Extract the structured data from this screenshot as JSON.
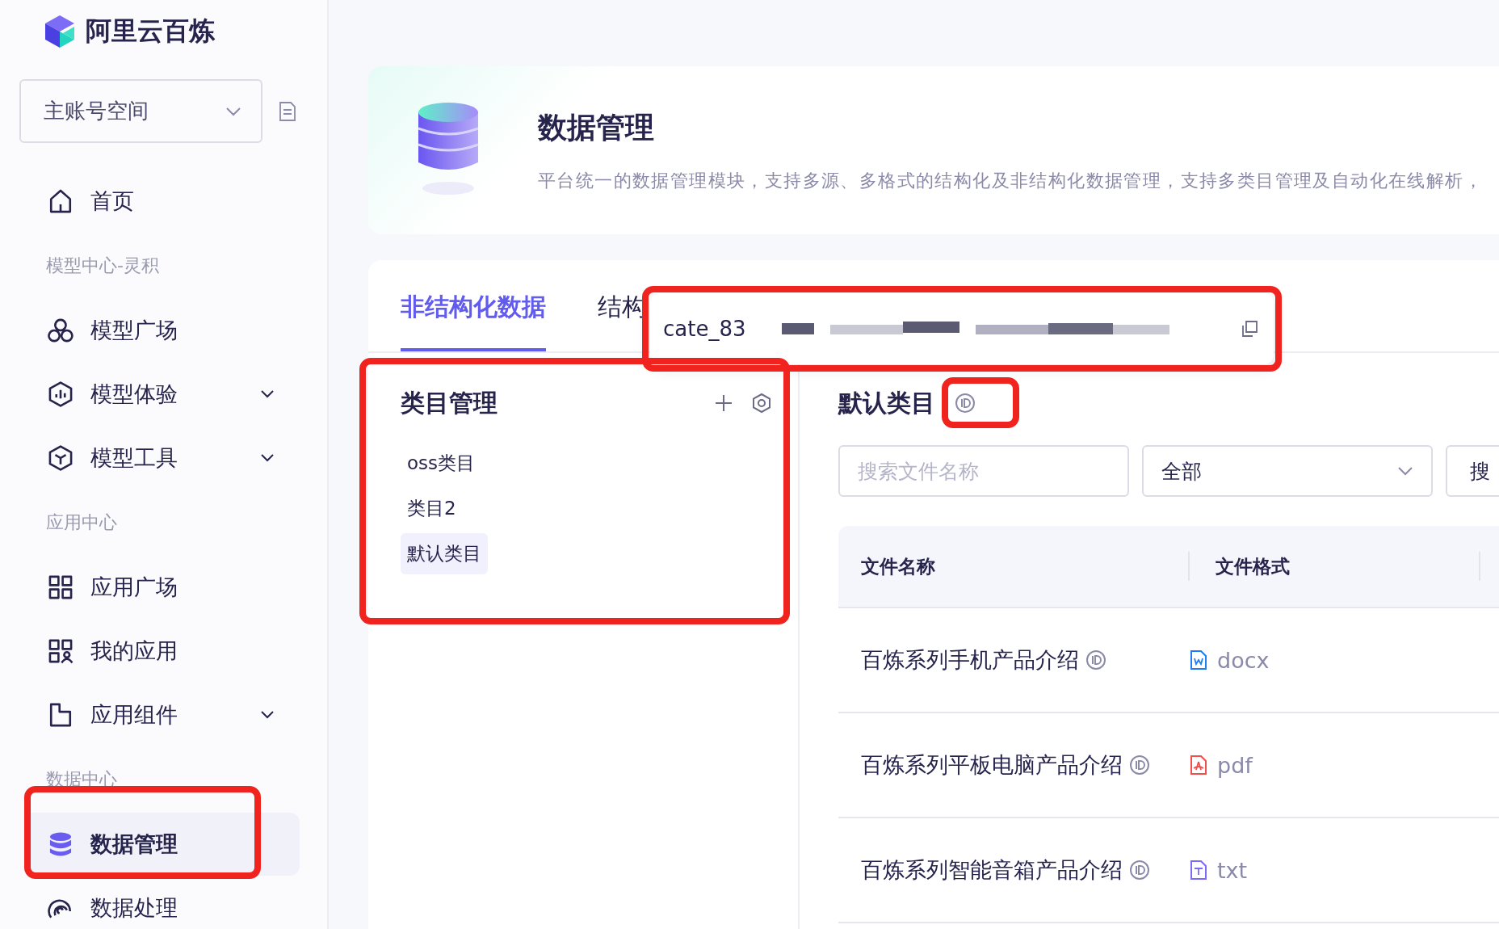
{
  "brand": {
    "name": "阿里云百炼"
  },
  "workspace": {
    "value": "主账号空间"
  },
  "sidebar": {
    "items": [
      {
        "kind": "item",
        "label": "首页",
        "has_submenu": false,
        "selected": false
      },
      {
        "kind": "section",
        "label": "模型中心-灵积"
      },
      {
        "kind": "item",
        "label": "模型广场",
        "has_submenu": false,
        "selected": false
      },
      {
        "kind": "item",
        "label": "模型体验",
        "has_submenu": true,
        "selected": false
      },
      {
        "kind": "item",
        "label": "模型工具",
        "has_submenu": true,
        "selected": false
      },
      {
        "kind": "section",
        "label": "应用中心"
      },
      {
        "kind": "item",
        "label": "应用广场",
        "has_submenu": false,
        "selected": false
      },
      {
        "kind": "item",
        "label": "我的应用",
        "has_submenu": false,
        "selected": false
      },
      {
        "kind": "item",
        "label": "应用组件",
        "has_submenu": true,
        "selected": false
      },
      {
        "kind": "section",
        "label": "数据中心"
      },
      {
        "kind": "item",
        "label": "数据管理",
        "has_submenu": false,
        "selected": true
      },
      {
        "kind": "item",
        "label": "数据处理",
        "has_submenu": false,
        "selected": false
      }
    ]
  },
  "header": {
    "title": "数据管理",
    "description": "平台统一的数据管理模块，支持多源、多格式的结构化及非结构化数据管理，支持多类目管理及自动化在线解析，"
  },
  "tabs": [
    {
      "label": "非结构化数据",
      "selected": true
    },
    {
      "label": "结构",
      "selected": false
    }
  ],
  "tooltip": {
    "text": "cate_83"
  },
  "categories": {
    "title": "类目管理",
    "items": [
      {
        "label": "oss类目",
        "selected": false
      },
      {
        "label": "类目2",
        "selected": false
      },
      {
        "label": "默认类目",
        "selected": true
      }
    ]
  },
  "files": {
    "title": "默认类目",
    "search": {
      "placeholder": "搜索文件名称"
    },
    "filter": {
      "value": "全部"
    },
    "search_button": {
      "label": "搜"
    },
    "columns": [
      "文件名称",
      "文件格式"
    ],
    "rows": [
      {
        "name": "百炼系列手机产品介绍",
        "format": "docx",
        "kind": "word",
        "color": "#1f7cf2"
      },
      {
        "name": "百炼系列平板电脑产品介绍",
        "format": "pdf",
        "kind": "pdf",
        "color": "#f0504c"
      },
      {
        "name": "百炼系列智能音箱产品介绍",
        "format": "txt",
        "kind": "text",
        "color": "#7b6cf6"
      }
    ]
  }
}
